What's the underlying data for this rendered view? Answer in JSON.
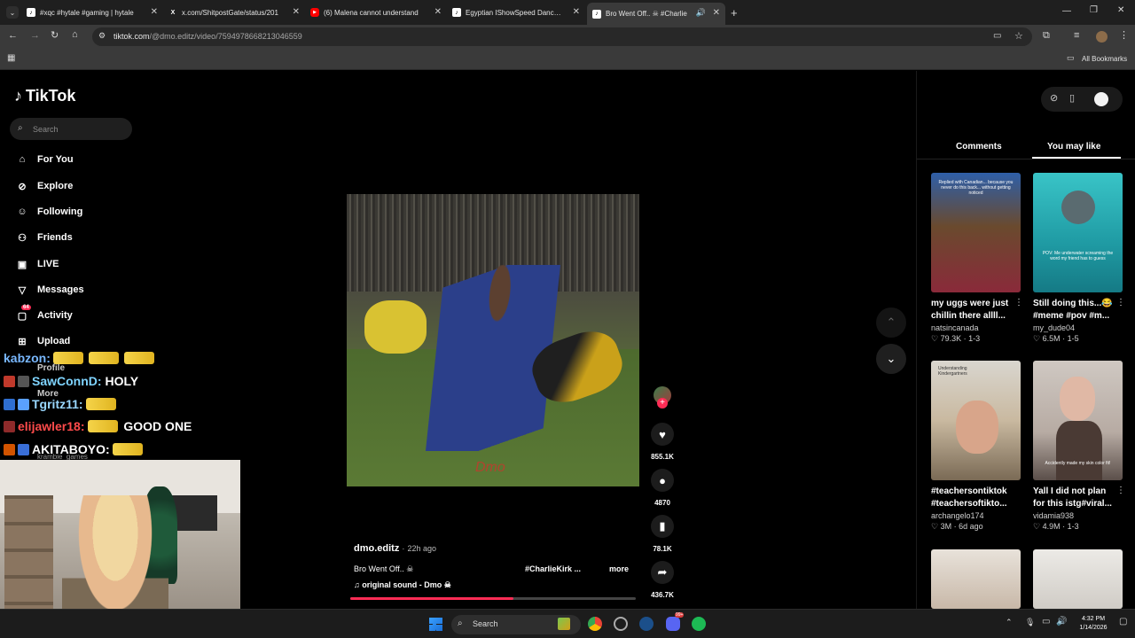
{
  "browser": {
    "tabs": [
      {
        "title": "#xqc #hytale #gaming | hytale"
      },
      {
        "title": "x.com/ShitpostGate/status/201"
      },
      {
        "title": "(6) Malena cannot understand"
      },
      {
        "title": "Egyptian IShowSpeed Dance O"
      },
      {
        "title": "Bro Went Off.. ☠ #Charlie"
      }
    ],
    "url_host": "tiktok.com",
    "url_path": "/@dmo.editz/video/7594978668213046559",
    "bookmarks_label": "All Bookmarks"
  },
  "tiktok": {
    "logo": "TikTok",
    "search_placeholder": "Search",
    "nav": [
      {
        "label": "For You"
      },
      {
        "label": "Explore"
      },
      {
        "label": "Following"
      },
      {
        "label": "Friends"
      },
      {
        "label": "LIVE"
      },
      {
        "label": "Messages"
      },
      {
        "label": "Activity",
        "badge": "64"
      },
      {
        "label": "Upload"
      },
      {
        "label": "Profile"
      },
      {
        "label": "More"
      }
    ],
    "video": {
      "author": "dmo.editz",
      "age": "22h ago",
      "caption": "Bro Went Off.. ☠",
      "hashtag": "#CharlieKirk ...",
      "more": "more",
      "sound": "original sound - Dmo ☠",
      "watermark": "Dmo",
      "likes": "855.1K",
      "comments": "4870",
      "saves": "78.1K",
      "shares": "436.7K",
      "progress": 0.57
    },
    "right_tabs": {
      "comments": "Comments",
      "you_may_like": "You may like"
    },
    "cards": [
      {
        "title": "my uggs were just chillin there allll...",
        "author": "natsincanada",
        "likes": "79.3K",
        "meta": "1-3",
        "thumb_text": "Replied with Canadian... because you never do this back... without getting noticed"
      },
      {
        "title": "Still doing this...😂 #meme #pov #m...",
        "author": "my_dude04",
        "likes": "6.5M",
        "meta": "1-5",
        "thumb_text": "POV: Me underwater screaming the word my friend has to guess"
      },
      {
        "title": "#teachersontiktok #teachersoftikto...",
        "author": "archangelo174",
        "likes": "3M",
        "meta": "6d ago",
        "thumb_text": "Understanding Kindergartners"
      },
      {
        "title": "Yall I did not plan for this istg#viral...",
        "author": "vidamia938",
        "likes": "4.9M",
        "meta": "1-3",
        "thumb_text": "Accidently made my skin color fit!"
      }
    ]
  },
  "chat": [
    {
      "user": "kabzon:",
      "msg": "",
      "color": "#79b8ff"
    },
    {
      "user": "SawConnD:",
      "msg": "HOLY",
      "color": "#7fd4ff"
    },
    {
      "user": "Tgritz11:",
      "msg": "",
      "color": "#9ad8ff"
    },
    {
      "user": "elijawler18:",
      "msg": "GOOD ONE",
      "color": "#ff4b4b"
    },
    {
      "user": "AKITABOYO:",
      "msg": "",
      "color": "#ffffff"
    }
  ],
  "chat_underlay": {
    "line1": "kramble_games"
  },
  "taskbar": {
    "search": "Search",
    "time": "4:32 PM",
    "date": "1/14/2026",
    "discord_badge": "99+"
  }
}
